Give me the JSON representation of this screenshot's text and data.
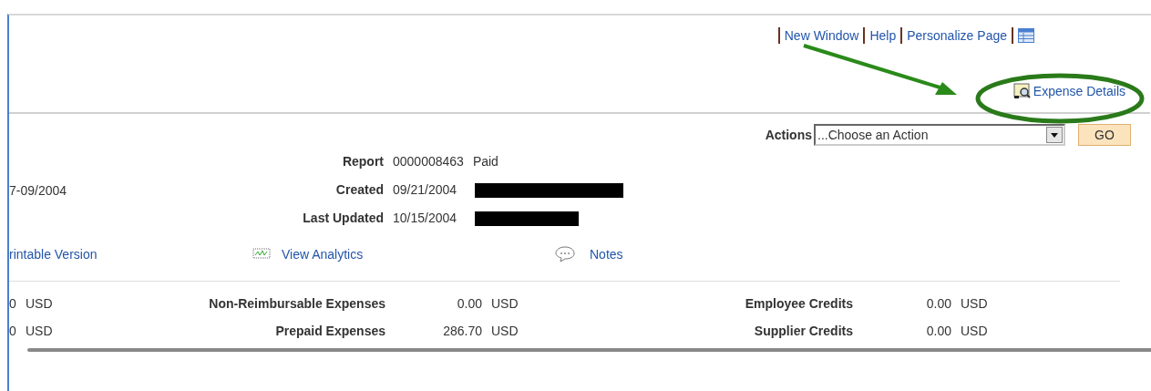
{
  "header_links": [
    {
      "label": "New Window"
    },
    {
      "label": "Help"
    },
    {
      "label": "Personalize Page"
    }
  ],
  "expense_details_link": "Expense Details",
  "actions": {
    "label": "Actions",
    "value": "...Choose an Action",
    "button": "GO"
  },
  "date_range": "7-09/2004",
  "report_fields": [
    {
      "label": "Report",
      "value": "0000008463",
      "extra": "Paid",
      "redacted": false
    },
    {
      "label": "Created",
      "value": "09/21/2004",
      "redacted": true
    },
    {
      "label": "Last Updated",
      "value": "10/15/2004",
      "redacted": true
    }
  ],
  "links": [
    {
      "label": "rintable Version",
      "kind": "plain"
    },
    {
      "label": "View Analytics",
      "kind": "analytics"
    },
    {
      "label": "Notes",
      "kind": "notes"
    }
  ],
  "summary_rows": [
    {
      "column_1": "0",
      "column_1_currency": "USD",
      "label": "Non-Reimbursable Expenses",
      "amount": "0.00",
      "currency": "USD",
      "label_2": "Employee Credits",
      "amount_2": "0.00",
      "currency_2": "USD"
    },
    {
      "column_1": "0",
      "column_1_currency": "USD",
      "label": "Prepaid Expenses",
      "amount": "286.70",
      "currency": "USD",
      "label_2": "Supplier Credits",
      "amount_2": "0.00",
      "currency_2": "USD"
    }
  ]
}
